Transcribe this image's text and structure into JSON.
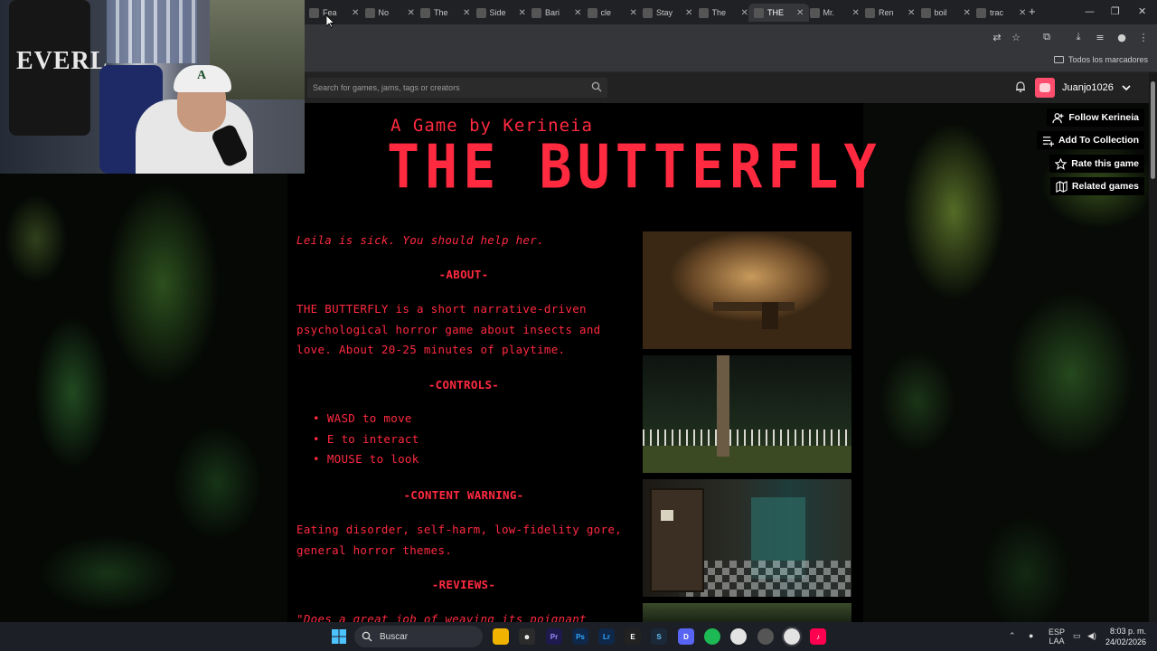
{
  "browser": {
    "tabs": [
      {
        "label": "Fea"
      },
      {
        "label": "No"
      },
      {
        "label": "The"
      },
      {
        "label": "Side"
      },
      {
        "label": "Bari"
      },
      {
        "label": "cle"
      },
      {
        "label": "Stay"
      },
      {
        "label": "The"
      },
      {
        "label": "THE",
        "active": true
      },
      {
        "label": "Mr."
      },
      {
        "label": "Ren"
      },
      {
        "label": "boil"
      },
      {
        "label": "trac"
      }
    ],
    "bookmarks_label": "Todos los marcadores"
  },
  "itch_header": {
    "search_placeholder": "Search for games, jams, tags or creators",
    "username": "Juanjo1026"
  },
  "actions": {
    "follow": "Follow Kerineia",
    "collection": "Add To Collection",
    "rate": "Rate this game",
    "related": "Related games"
  },
  "game": {
    "byline": "A Game by Kerineia",
    "title": "THE BUTTERFLY",
    "tagline": "Leila is sick. You should help her.",
    "about_heading": "-ABOUT-",
    "about_text": "THE BUTTERFLY is a short narrative-driven psychological horror game about insects and love. About 20-25 minutes of playtime.",
    "controls_heading": "-CONTROLS-",
    "controls": [
      "WASD to move",
      "E to interact",
      "MOUSE to look"
    ],
    "warning_heading": "-CONTENT WARNING-",
    "warning_text": "Eating disorder, self-harm, low-fidelity gore, general horror themes.",
    "reviews_heading": "-REVIEWS-",
    "review_text": "\"Does a great job of weaving its poignant"
  },
  "webcam": {
    "bag_text": "EVERL"
  },
  "taskbar": {
    "search_label": "Buscar",
    "lang_top": "ESP",
    "lang_bottom": "LAA",
    "time": "8:03 p. m.",
    "date": "24/02/2026"
  },
  "colors": {
    "accent_red": "#ff2a40",
    "page_bg": "#000000",
    "itch_header": "#222222"
  }
}
